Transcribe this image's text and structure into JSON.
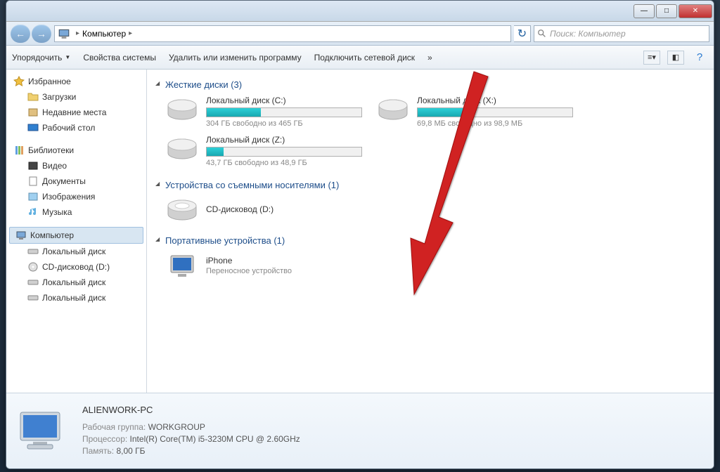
{
  "titlebar": {
    "minimize": "—",
    "maximize": "□",
    "close": "✕"
  },
  "address": {
    "location": "Компьютер",
    "search_placeholder": "Поиск: Компьютер"
  },
  "toolbar": {
    "organize": "Упорядочить",
    "properties": "Свойства системы",
    "uninstall": "Удалить или изменить программу",
    "map_drive": "Подключить сетевой диск",
    "more": "»"
  },
  "sidebar": {
    "favorites": {
      "label": "Избранное",
      "items": [
        "Загрузки",
        "Недавние места",
        "Рабочий стол"
      ]
    },
    "libraries": {
      "label": "Библиотеки",
      "items": [
        "Видео",
        "Документы",
        "Изображения",
        "Музыка"
      ]
    },
    "computer": {
      "label": "Компьютер",
      "items": [
        "Локальный диск",
        "CD-дисковод (D:)",
        "Локальный диск",
        "Локальный диск"
      ]
    }
  },
  "sections": {
    "hdd": "Жесткие диски (3)",
    "removable": "Устройства со съемными носителями (1)",
    "portable": "Портативные устройства (1)"
  },
  "drives": {
    "c": {
      "name": "Локальный диск (C:)",
      "free": "304 ГБ свободно из 465 ГБ",
      "fillPct": 35
    },
    "x": {
      "name": "Локальный диск (X:)",
      "free": "69,8 МБ свободно из 98,9 МБ",
      "fillPct": 30
    },
    "z": {
      "name": "Локальный диск (Z:)",
      "free": "43,7 ГБ свободно из 48,9 ГБ",
      "fillPct": 11
    },
    "cd": {
      "name": "CD-дисковод (D:)"
    }
  },
  "portable": {
    "name": "iPhone",
    "sub": "Переносное устройство"
  },
  "details": {
    "name": "ALIENWORK-PC",
    "workgroup_label": "Рабочая группа:",
    "workgroup": "WORKGROUP",
    "cpu_label": "Процессор:",
    "cpu": "Intel(R) Core(TM) i5-3230M CPU @ 2.60GHz",
    "ram_label": "Память:",
    "ram": "8,00 ГБ"
  }
}
